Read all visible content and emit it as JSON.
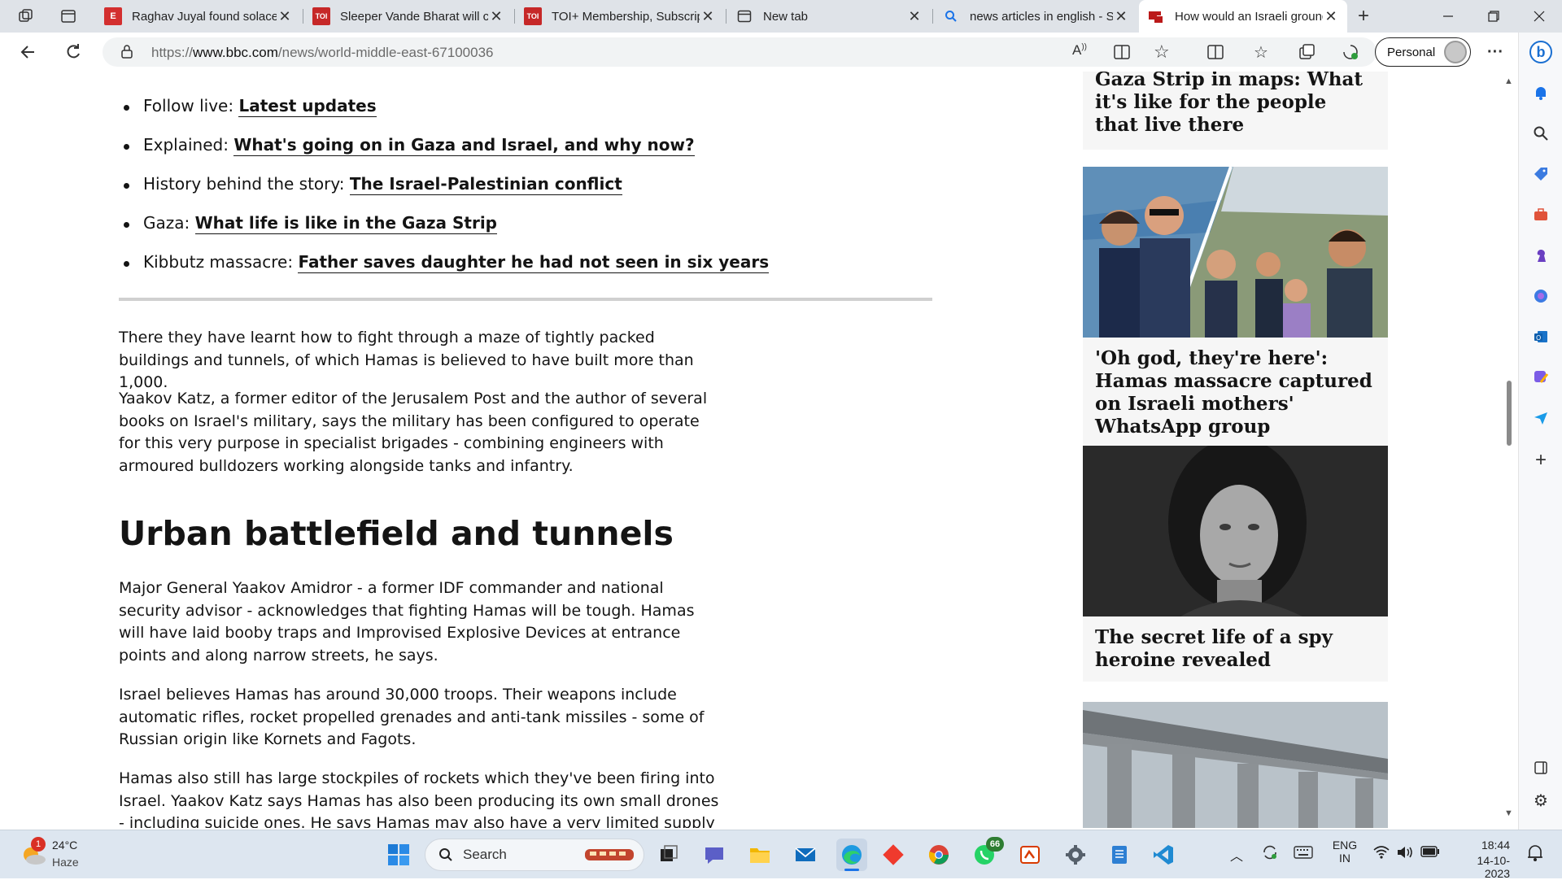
{
  "browser": {
    "tabs": [
      {
        "title": "Raghav Juyal found solace in a Q",
        "favicon": "E",
        "color": "#d32f2f"
      },
      {
        "title": "Sleeper Vande Bharat will come",
        "favicon": "TOI",
        "color": "#c62828"
      },
      {
        "title": "TOI+ Membership, Subscription",
        "favicon": "TOI",
        "color": "#c62828"
      },
      {
        "title": "New tab",
        "favicon": "newtab-icon",
        "color": "#444444"
      },
      {
        "title": "news articles in english - Search",
        "favicon": "search-icon",
        "color": "#1a73e8"
      },
      {
        "title": "How would an Israeli ground inva",
        "favicon": "bbc-icon",
        "color": "#bb1919"
      }
    ],
    "url_prefix": "https://",
    "url_domain": "www.bbc.com",
    "url_path": "/news/world-middle-east-67100036",
    "profile_label": "Personal"
  },
  "article": {
    "links": [
      {
        "prefix": "Follow live: ",
        "link": "Latest updates"
      },
      {
        "prefix": "Explained: ",
        "link": "What's going on in Gaza and Israel, and why now?"
      },
      {
        "prefix": "History behind the story: ",
        "link": "The Israel-Palestinian conflict"
      },
      {
        "prefix": "Gaza: ",
        "link": "What life is like in the Gaza Strip"
      },
      {
        "prefix": "Kibbutz massacre: ",
        "link": "Father saves daughter he had not seen in six years"
      }
    ],
    "para1": "There they have learnt how to fight through a maze of tightly packed buildings and tunnels, of which Hamas is believed to have built more than 1,000.",
    "para2": "Yaakov Katz, a former editor of the Jerusalem Post and the author of several books on Israel's military, says the military has been configured to operate for this very purpose in specialist brigades - combining engineers with armoured bulldozers working alongside tanks and infantry.",
    "subheading": "Urban battlefield and tunnels",
    "para3": "Major General Yaakov Amidror - a former IDF commander and national security advisor - acknowledges that fighting Hamas will be tough. Hamas will have laid booby traps and Improvised Explosive Devices at entrance points and along narrow streets, he says.",
    "para4": "Israel believes Hamas has around 30,000 troops. Their weapons include automatic rifles, rocket propelled grenades and anti-tank missiles - some of Russian origin like Kornets and Fagots.",
    "para5": "Hamas also still has large stockpiles of rockets which they've been firing into Israel. Yaakov Katz says Hamas has also been producing its own small drones - including suicide ones. He says Hamas may also have a very limited supply of"
  },
  "sidebar_cards": [
    {
      "caption": "Gaza Strip in maps: What it's like for the people that live there"
    },
    {
      "caption": "'Oh god, they're here': Hamas massacre captured on Israeli mothers' WhatsApp group"
    },
    {
      "caption": "The secret life of a spy heroine revealed"
    }
  ],
  "taskbar": {
    "weather_temp": "24°C",
    "weather_desc": "Haze",
    "weather_badge": "1",
    "search_placeholder": "Search",
    "whatsapp_badge": "66",
    "lang_top": "ENG",
    "lang_bottom": "IN",
    "time": "18:44",
    "date": "14-10-2023"
  }
}
